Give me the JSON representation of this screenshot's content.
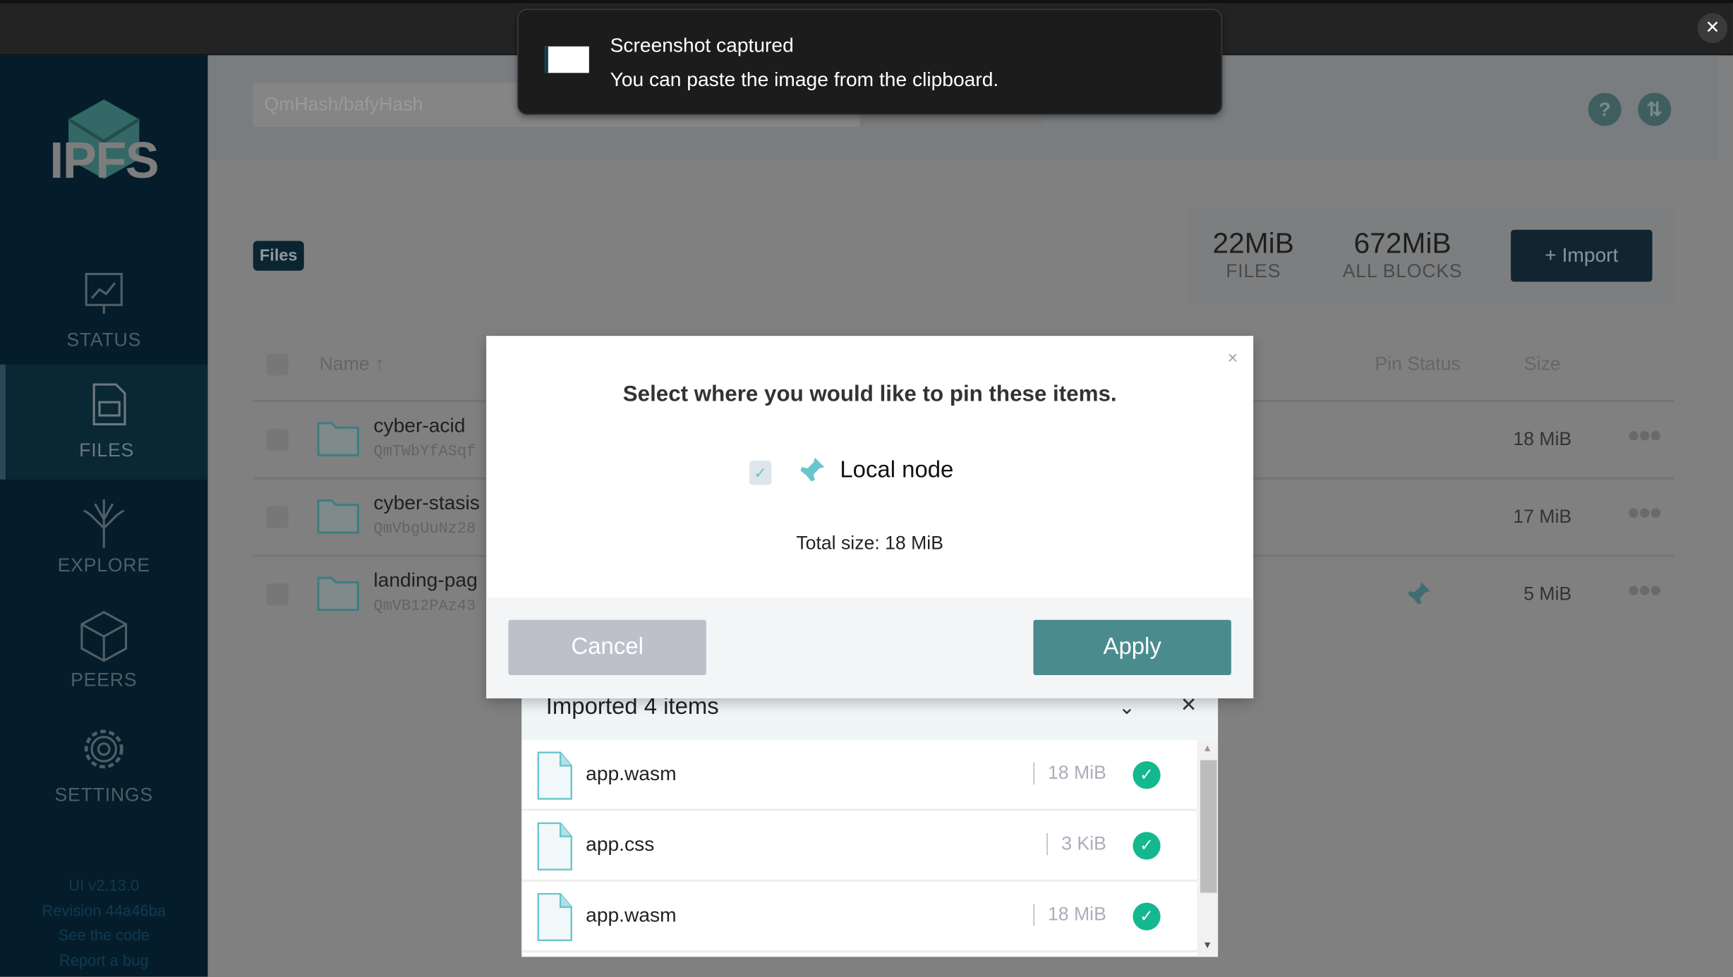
{
  "toast": {
    "title": "Screenshot captured",
    "message": "You can paste the image from the clipboard."
  },
  "sidebar": {
    "logo": "IPFS",
    "items": [
      {
        "label": "STATUS",
        "icon": "status-icon"
      },
      {
        "label": "FILES",
        "icon": "files-icon",
        "active": true
      },
      {
        "label": "EXPLORE",
        "icon": "explore-icon"
      },
      {
        "label": "PEERS",
        "icon": "peers-icon"
      },
      {
        "label": "SETTINGS",
        "icon": "settings-icon"
      }
    ],
    "footer": {
      "version": "UI v2.13.0",
      "revision": "Revision 44a46ba",
      "code": "See the code",
      "bug": "Report a bug"
    }
  },
  "header": {
    "search_placeholder": "QmHash/bafyHash",
    "help": "?",
    "transfer": "⇅"
  },
  "files": {
    "breadcrumb": "Files",
    "stats": [
      {
        "value": "22MiB",
        "label": "FILES"
      },
      {
        "value": "672MiB",
        "label": "ALL BLOCKS"
      }
    ],
    "import_label": "+ Import",
    "columns": {
      "name": "Name ↑",
      "pin": "Pin Status",
      "size": "Size"
    },
    "rows": [
      {
        "name": "cyber-acid",
        "hash": "QmTWbYfASqf",
        "size": "18 MiB",
        "pinned": false
      },
      {
        "name": "cyber-stasis",
        "hash": "QmVbgUuNz28",
        "size": "17 MiB",
        "pinned": false
      },
      {
        "name": "landing-pag",
        "hash": "QmVB12PAz43",
        "size": "5 MiB",
        "pinned": true
      }
    ]
  },
  "modal": {
    "title": "Select where you would like to pin these items.",
    "option": "Local node",
    "option_checked": true,
    "total": "Total size: 18 MiB",
    "cancel": "Cancel",
    "apply": "Apply",
    "close": "×"
  },
  "imports": {
    "title": "Imported 4 items",
    "items": [
      {
        "name": "app.wasm",
        "size": "18 MiB"
      },
      {
        "name": "app.css",
        "size": "3 KiB"
      },
      {
        "name": "app.wasm",
        "size": "18 MiB"
      }
    ]
  },
  "colors": {
    "accent": "#4a8b8e",
    "navy": "#0b3a53",
    "success": "#14b88e"
  }
}
